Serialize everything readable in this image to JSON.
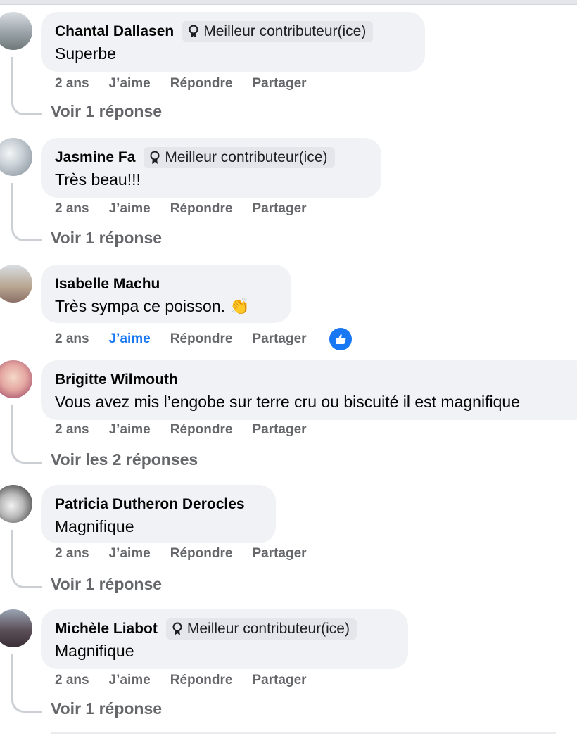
{
  "labels": {
    "age": "2 ans",
    "like": "J’aime",
    "reply": "Répondre",
    "share": "Partager",
    "top_contributor": "Meilleur contributeur(ice)"
  },
  "comments": [
    {
      "author": "Chantal Dallasen",
      "badge": true,
      "text": "Superbe",
      "replies": "Voir 1 réponse",
      "liked": false
    },
    {
      "author": "Jasmine Fa",
      "badge": true,
      "text": "Très beau!!!",
      "replies": "Voir 1 réponse",
      "liked": false
    },
    {
      "author": "Isabelle Machu",
      "badge": false,
      "text": "Très sympa ce poisson. 👏",
      "replies": "",
      "liked": true
    },
    {
      "author": "Brigitte Wilmouth",
      "badge": false,
      "text": "Vous avez mis l’engobe sur terre cru ou biscuité il est magnifique",
      "replies": "Voir les 2 réponses",
      "liked": false
    },
    {
      "author": "Patricia Dutheron Derocles",
      "badge": false,
      "text": "Magnifique",
      "replies": "Voir 1 réponse",
      "liked": false
    },
    {
      "author": "Michèle Liabot",
      "badge": true,
      "text": "Magnifique",
      "replies": "Voir 1 réponse",
      "liked": false
    }
  ],
  "colors": {
    "bubble": "#f0f2f5",
    "muted": "#65676b",
    "accent": "#1877f2",
    "line": "#ccd0d5"
  }
}
